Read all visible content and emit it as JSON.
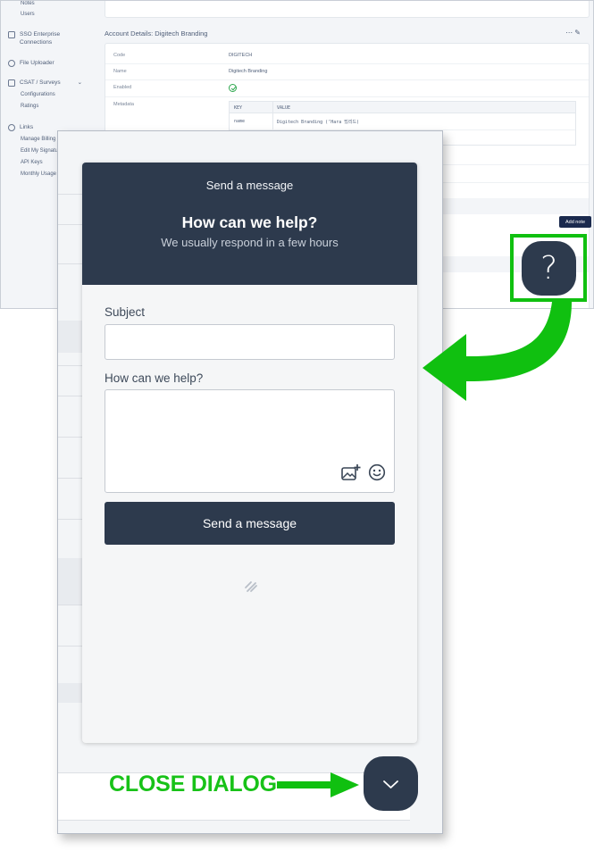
{
  "background_app": {
    "sidebar": {
      "top_items": [
        "Notes",
        "Users"
      ],
      "sso": "SSO Enterprise Connections",
      "sso_line1": "SSO Enterprise",
      "sso_line2": "Connections",
      "file_uploader": "File Uploader",
      "csat": "CSAT / Surveys",
      "csat_subitems": [
        "Configurations",
        "Ratings"
      ],
      "links": "Links",
      "links_subitems": [
        "Manage Billing",
        "Edit My Signature",
        "API Keys",
        "Monthly Usage F"
      ]
    },
    "account": {
      "title": "Account Details: Digitech Branding",
      "actions": "⋯  ✎",
      "rows": [
        {
          "label": "Code",
          "value": "DIGITECH"
        },
        {
          "label": "Name",
          "value": "Digitech Branding"
        },
        {
          "label": "Enabled",
          "value": ""
        },
        {
          "label": "Metadata",
          "value": ""
        }
      ],
      "metadata_table": {
        "headers": [
          "KEY",
          "VALUE"
        ],
        "rows": [
          [
            "name",
            "Digitech Branding (’Hara 밌리드)"
          ]
        ]
      }
    },
    "add_note_label": "Add note"
  },
  "widget": {
    "header_top": "Send a message",
    "title": "How can we help?",
    "subtitle": "We usually respond in a few hours",
    "subject_label": "Subject",
    "subject_value": "",
    "message_label": "How can we help?",
    "message_value": "",
    "send_label": "Send a message"
  },
  "launcher": {
    "help_glyph": "?"
  },
  "annotation": {
    "close_label": "CLOSE DIALOG",
    "accent_color": "#10c010"
  },
  "colors": {
    "header_bg": "#2d3a4d",
    "widget_bg": "#f5f6f7",
    "button_bg": "#2d3a4d"
  }
}
